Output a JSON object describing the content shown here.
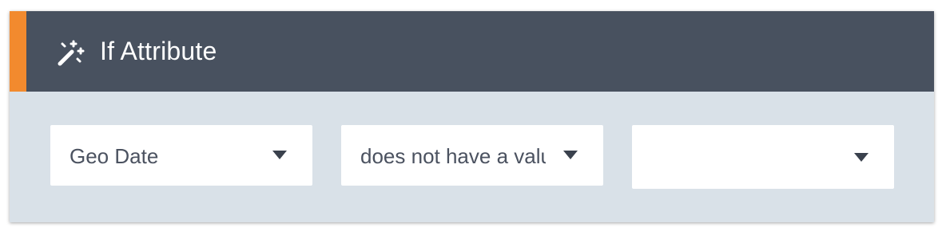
{
  "colors": {
    "header_bg": "#48515f",
    "accent": "#f28a2e",
    "body_bg": "#d9e1e8",
    "select_bg": "#ffffff",
    "text": "#4b5260"
  },
  "header": {
    "icon": "magic-wand-icon",
    "title": "If Attribute"
  },
  "conditions": {
    "attribute_value": "Geo Date",
    "operator_value": "does not have a value",
    "third_value": ""
  }
}
